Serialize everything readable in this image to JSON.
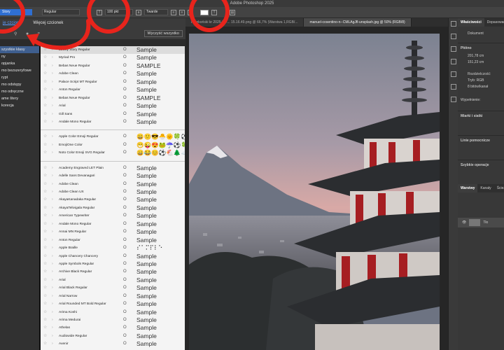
{
  "window": {
    "title": "Adobe Photoshop 2025"
  },
  "options_bar": {
    "font_family": "Story",
    "font_style": "Regular",
    "font_size": "100 pkt",
    "antialias": "Twarde"
  },
  "font_panel": {
    "link_fonts": "je czcion",
    "more_fonts": "Więcej czcionek",
    "clear_all": "Wyczyść wszystko",
    "filter_icons": [
      "☆",
      "★",
      "≈"
    ]
  },
  "classes": [
    "szystkie klasy",
    "ny",
    "opjanka",
    "mo bezszeryfowe",
    "rypt",
    "mo odstępy",
    "mo odręczne",
    "ame štery",
    "korecja"
  ],
  "doc_tabs": [
    {
      "label": "Przekoński kr 2025-06-... 15.16.49.png @ 66,7% (Warstwa 1,RGB/..."
    },
    {
      "label": "manuel-cosentino-n--CMLAgJfl-unsplash.jpg @ 50% (RGB/8)"
    }
  ],
  "fonts_group1": [
    {
      "name": "Lovely Story Regular",
      "sample": "Sample"
    },
    {
      "name": "Myriad Pro",
      "sample": "Sample"
    },
    {
      "name": "Bebas Neue Regular",
      "sample": "SAMPLE"
    },
    {
      "name": "Adobe Clean",
      "sample": "Sample"
    },
    {
      "name": "Palace Script MT Regular",
      "sample": "Sample"
    },
    {
      "name": "Anton Regular",
      "sample": "Sample"
    },
    {
      "name": "Bebas Neue Regular",
      "sample": "SAMPLE"
    },
    {
      "name": "Arial",
      "sample": "Sample"
    },
    {
      "name": "Gill Sans",
      "sample": "Sample"
    },
    {
      "name": "Andale Mono Regular",
      "sample": "Sample"
    }
  ],
  "fonts_group2": [
    {
      "name": "Apple Color Emoji Regular",
      "sample": "😀🙂😎🐣🌞🍀⚽"
    },
    {
      "name": "EmojiOne Color",
      "sample": "😁😜😍🐸☂️⚽🍀"
    },
    {
      "name": "Noto Color Emoji SVG Regular",
      "sample": "😄😂😊⚽🐔🌲☁️"
    }
  ],
  "fonts_group3": [
    {
      "name": "Academy Engraved LET Plain",
      "sample": "Sample"
    },
    {
      "name": "Adelle Sans Devanagari",
      "sample": "Sample"
    },
    {
      "name": "Adobe Clean",
      "sample": "Sample"
    },
    {
      "name": "Adobe Clean UX",
      "sample": "Sample"
    },
    {
      "name": "AkayaKanadaka Regular",
      "sample": "Sample"
    },
    {
      "name": "AkayaTelivigala Regular",
      "sample": "Sample"
    },
    {
      "name": "American Typewriter",
      "sample": "Sample"
    },
    {
      "name": "Andale Mono Regular",
      "sample": "Sample"
    },
    {
      "name": "Annai MN Regular",
      "sample": "Sample"
    },
    {
      "name": "Anton Regular",
      "sample": "Sample"
    },
    {
      "name": "Apple Braille",
      "sample": "⠎⠁⠍⠏⠇⠑"
    },
    {
      "name": "Apple Chancery Chancery",
      "sample": "Sample"
    },
    {
      "name": "Apple Symbols Regular",
      "sample": "Sample"
    },
    {
      "name": "Archive Black Regular",
      "sample": "Sample"
    },
    {
      "name": "Arial",
      "sample": "Sample"
    },
    {
      "name": "Arial Black Regular",
      "sample": "Sample"
    },
    {
      "name": "Arial Narrow",
      "sample": "Sample"
    },
    {
      "name": "Arial Rounded MT Bold Regular",
      "sample": "Sample"
    },
    {
      "name": "Arima Koshi",
      "sample": "Sample"
    },
    {
      "name": "Arima Medurai",
      "sample": "Sample"
    },
    {
      "name": "Athelas",
      "sample": "Sample"
    },
    {
      "name": "Audiowide Regular",
      "sample": "Sample"
    },
    {
      "name": "Avenir",
      "sample": "Sample"
    }
  ],
  "right_panel": {
    "tabs": [
      "Właściwości",
      "Dopasowanie"
    ],
    "doc_label": "Dokument",
    "canvas_section": "Płótno",
    "size_w": "201,78 cm",
    "size_h": "151,23 cm",
    "resolution_label": "Rozdzielczość:",
    "mode_label": "Tryb:",
    "mode_value": "RGB",
    "depth_value": "8 bitów/kanał",
    "fill_label": "Wypełnienie:",
    "rulers_section": "Miarki i siatki",
    "guides_section": "Linie pomocnicze",
    "quick_actions": "Szybkie operacje",
    "layers_tabs": [
      "Warstwy",
      "Kanały",
      "Ścieżki"
    ],
    "layer_name": "Tło"
  }
}
